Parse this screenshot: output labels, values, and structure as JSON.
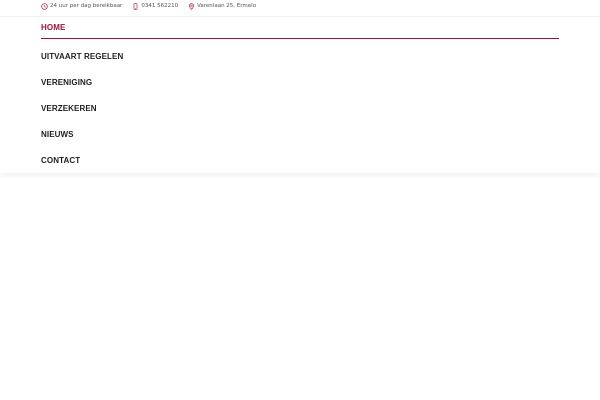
{
  "topbar": {
    "hours": {
      "icon": "clock-icon",
      "text": "24 uur per dag bereikbaar"
    },
    "phone": {
      "icon": "phone-icon",
      "text": "0341 562210"
    },
    "address": {
      "icon": "map-pin-icon",
      "text": "Varenlaan 25, Ermelo"
    }
  },
  "nav": {
    "items": [
      {
        "label": "HOME",
        "active": true
      },
      {
        "label": "UITVAART REGELEN",
        "active": false
      },
      {
        "label": "VERENIGING",
        "active": false
      },
      {
        "label": "VERZEKEREN",
        "active": false
      },
      {
        "label": "NIEUWS",
        "active": false
      },
      {
        "label": "CONTACT",
        "active": false
      }
    ]
  },
  "colors": {
    "accent": "#9c1538",
    "text": "#1f1f1f",
    "muted": "#555555"
  }
}
